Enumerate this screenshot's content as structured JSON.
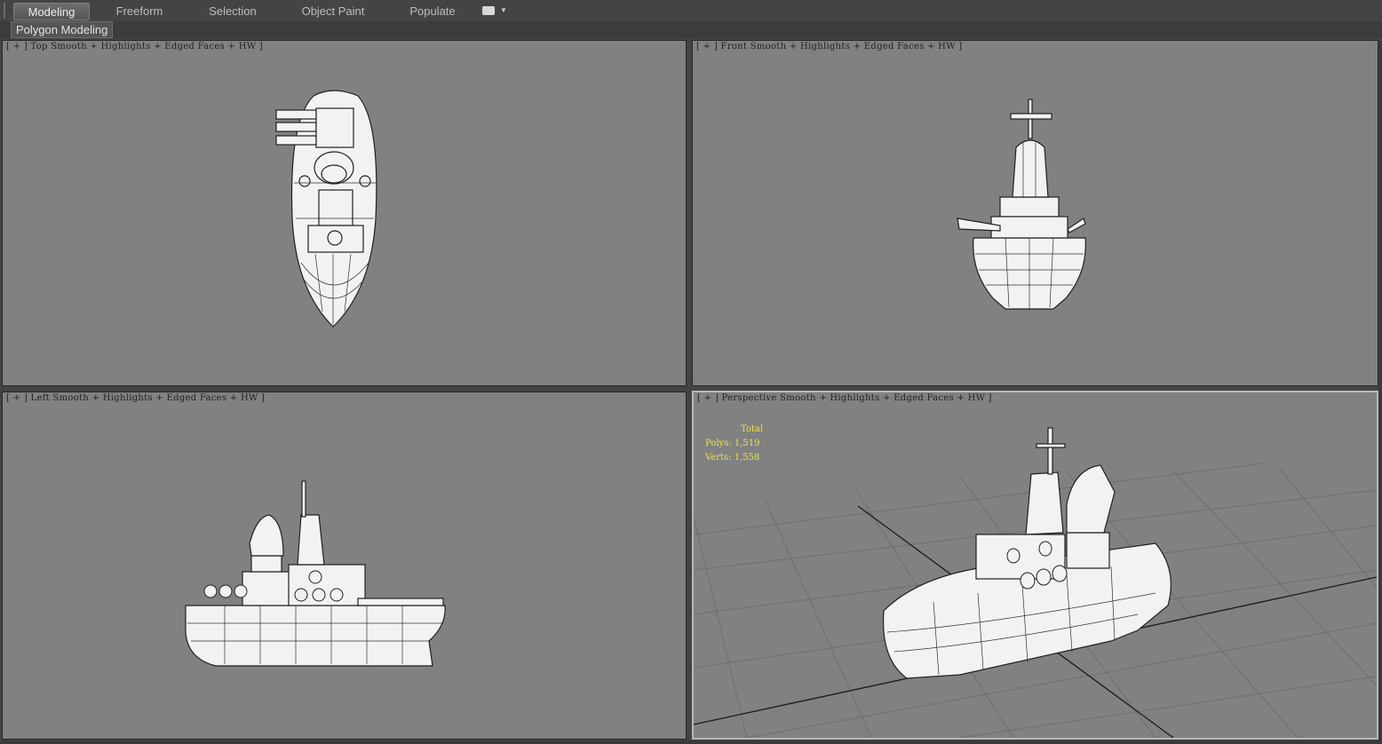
{
  "ribbon": {
    "tabs": [
      {
        "label": "Modeling",
        "active": true
      },
      {
        "label": "Freeform",
        "active": false
      },
      {
        "label": "Selection",
        "active": false
      },
      {
        "label": "Object Paint",
        "active": false
      },
      {
        "label": "Populate",
        "active": false
      }
    ],
    "panel_label": "Polygon Modeling"
  },
  "viewports": {
    "top": {
      "plus": "[ + ]",
      "view": "Top",
      "shading": "Smooth + Highlights + Edged Faces + HW ]"
    },
    "front": {
      "plus": "[ + ]",
      "view": "Front",
      "shading": "Smooth + Highlights + Edged Faces + HW ]"
    },
    "left": {
      "plus": "[ + ]",
      "view": "Left",
      "shading": "Smooth + Highlights + Edged Faces + HW ]"
    },
    "perspective": {
      "plus": "[ + ]",
      "view": "Perspective",
      "shading": "Smooth + Highlights + Edged Faces + HW ]"
    }
  },
  "stats": {
    "title": "Total",
    "polys": "Polys: 1,519",
    "verts": "Verts: 1,558"
  },
  "colors": {
    "viewport_bg": "#818181",
    "stats_text": "#f0e040",
    "active_border": "#b8b8b8"
  }
}
